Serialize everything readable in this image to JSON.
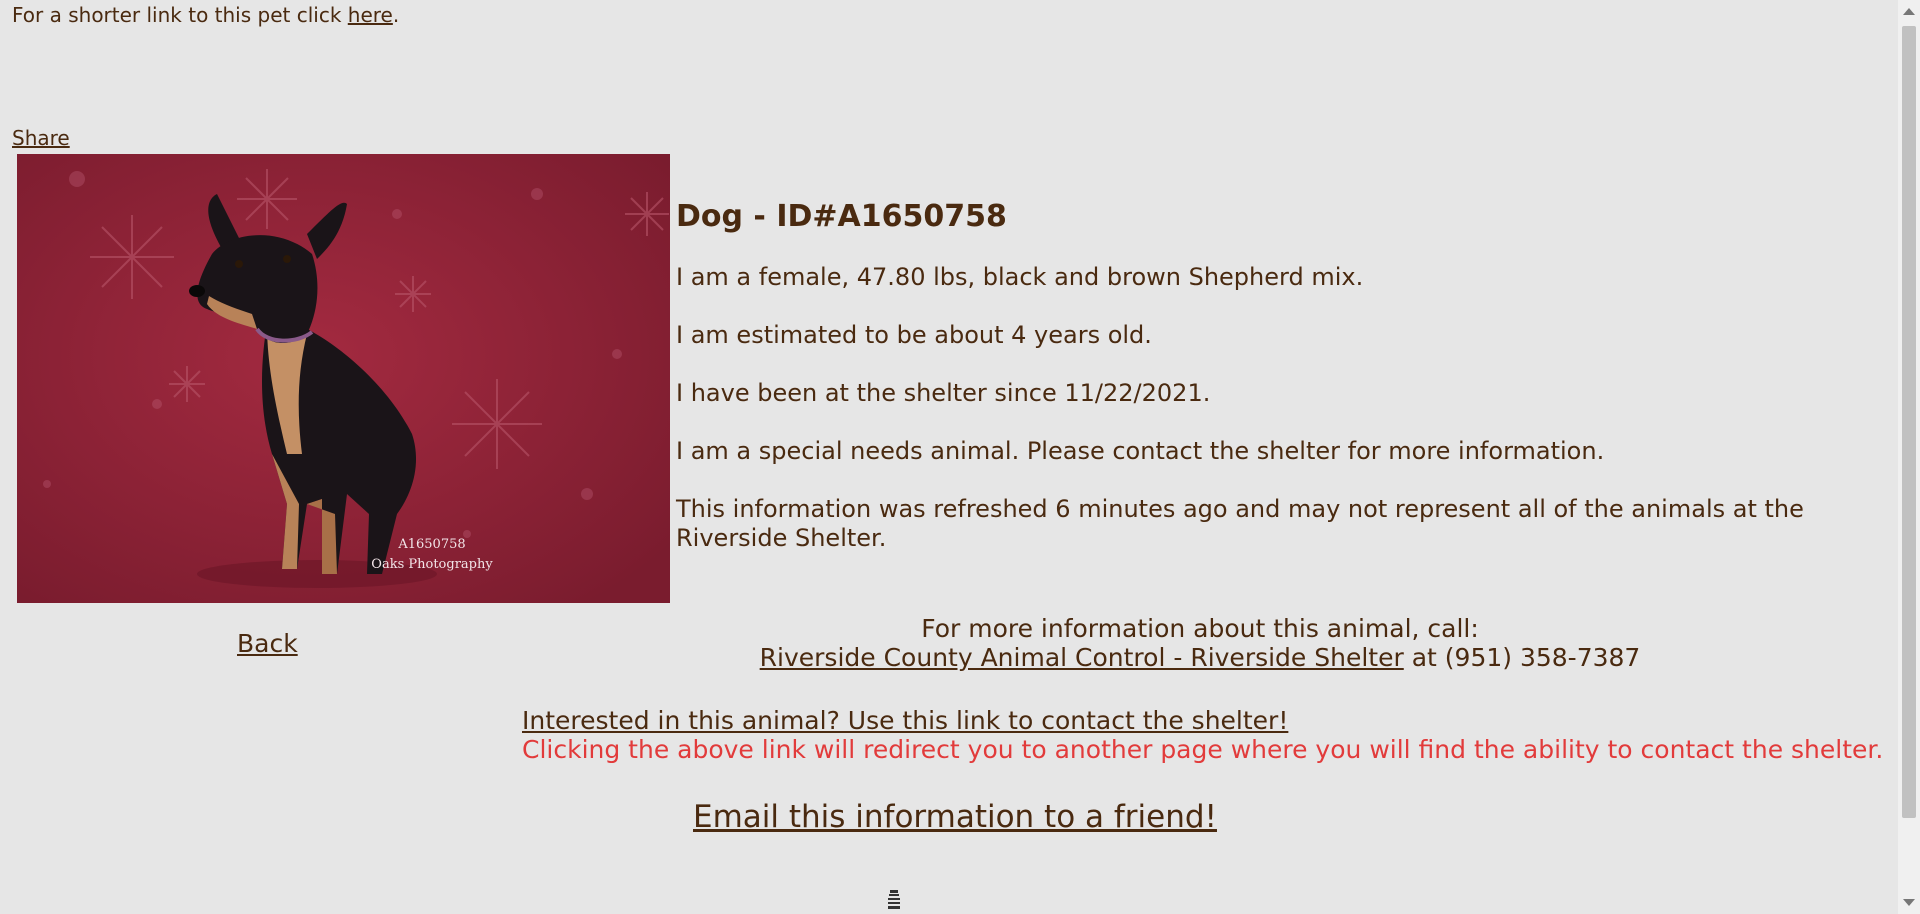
{
  "header": {
    "short_link_text": "For a shorter link to this pet click ",
    "short_link_anchor": "here",
    "short_link_period": "."
  },
  "share_label": "Share",
  "photo": {
    "watermark_id": "A1650758",
    "watermark_credit": "Oaks Photography",
    "background_color": "#8c2336"
  },
  "back_label": "Back",
  "animal": {
    "title": "Dog - ID#A1650758",
    "line1": "I am a female, 47.80 lbs, black and brown Shepherd mix.",
    "line2": "I am estimated to be about 4 years old.",
    "line3": "I have been at the shelter since 11/22/2021.",
    "line4": "I am a special needs animal. Please contact the shelter for more information.",
    "line5": "This information was refreshed 6 minutes ago and may not represent all of the animals at the Riverside Shelter."
  },
  "contact": {
    "prompt": "For more information about this animal, call:",
    "shelter_link": "Riverside County Animal Control - Riverside Shelter",
    "phone_text": " at (951) 358-7387"
  },
  "interest": {
    "link_text": "Interested in this animal? Use this link to contact the shelter!",
    "note": "Clicking the above link will redirect you to another page where you will find the ability to contact the shelter.",
    "note_color": "#e23b3b"
  },
  "email_label": "Email this information to a friend!"
}
